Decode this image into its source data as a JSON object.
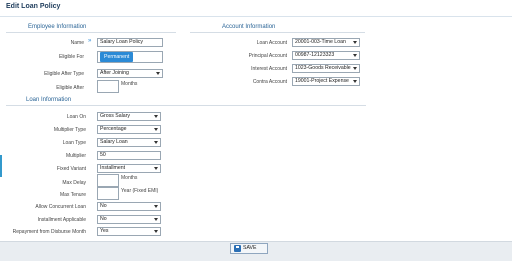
{
  "page": {
    "title": "Edit Loan Policy"
  },
  "employee": {
    "heading": "Employee Information",
    "name_label": "Name",
    "name_value": "Salary Loan Policy",
    "eligible_for_label": "Eligible For",
    "eligible_for_badge": "Permanent",
    "eligible_after_type_label": "Eligible After Type",
    "eligible_after_type_value": "After Joining",
    "eligible_after_label": "Eligible After",
    "eligible_after_suffix": "Months"
  },
  "account": {
    "heading": "Account Information",
    "loan_account_label": "Loan Account",
    "loan_account_value": "20001-003-Time Loan",
    "principal_account_label": "Principal Account",
    "principal_account_value": "00987-12123323",
    "interest_account_label": "Interest Account",
    "interest_account_value": "1023-Goods Receivable",
    "contra_account_label": "Contra Account",
    "contra_account_value": "19001-Project Expense"
  },
  "loan": {
    "heading": "Loan Information",
    "loan_on_label": "Loan On",
    "loan_on_value": "Gross Salary",
    "multiplier_type_label": "Multiplier Type",
    "multiplier_type_value": "Percentage",
    "loan_type_label": "Loan Type",
    "loan_type_value": "Salary Loan",
    "multiplier_label": "Multiplier",
    "multiplier_value": "50",
    "fixed_variant_label": "Fixed Variant",
    "fixed_variant_value": "Installment",
    "max_delay_label": "Max Delay",
    "max_delay_suffix": "Months",
    "max_tenure_label": "Max Tenure",
    "max_tenure_suffix": "Year (Fixed EMI)",
    "allow_concurrent_label": "Allow Concurrent Loan",
    "allow_concurrent_value": "No",
    "installment_applicable_label": "Installment Applicable",
    "installment_applicable_value": "No",
    "repayment_label": "Repayment from Disburse Month",
    "repayment_value": "Yes"
  },
  "footer": {
    "save_label": "SAVE"
  }
}
